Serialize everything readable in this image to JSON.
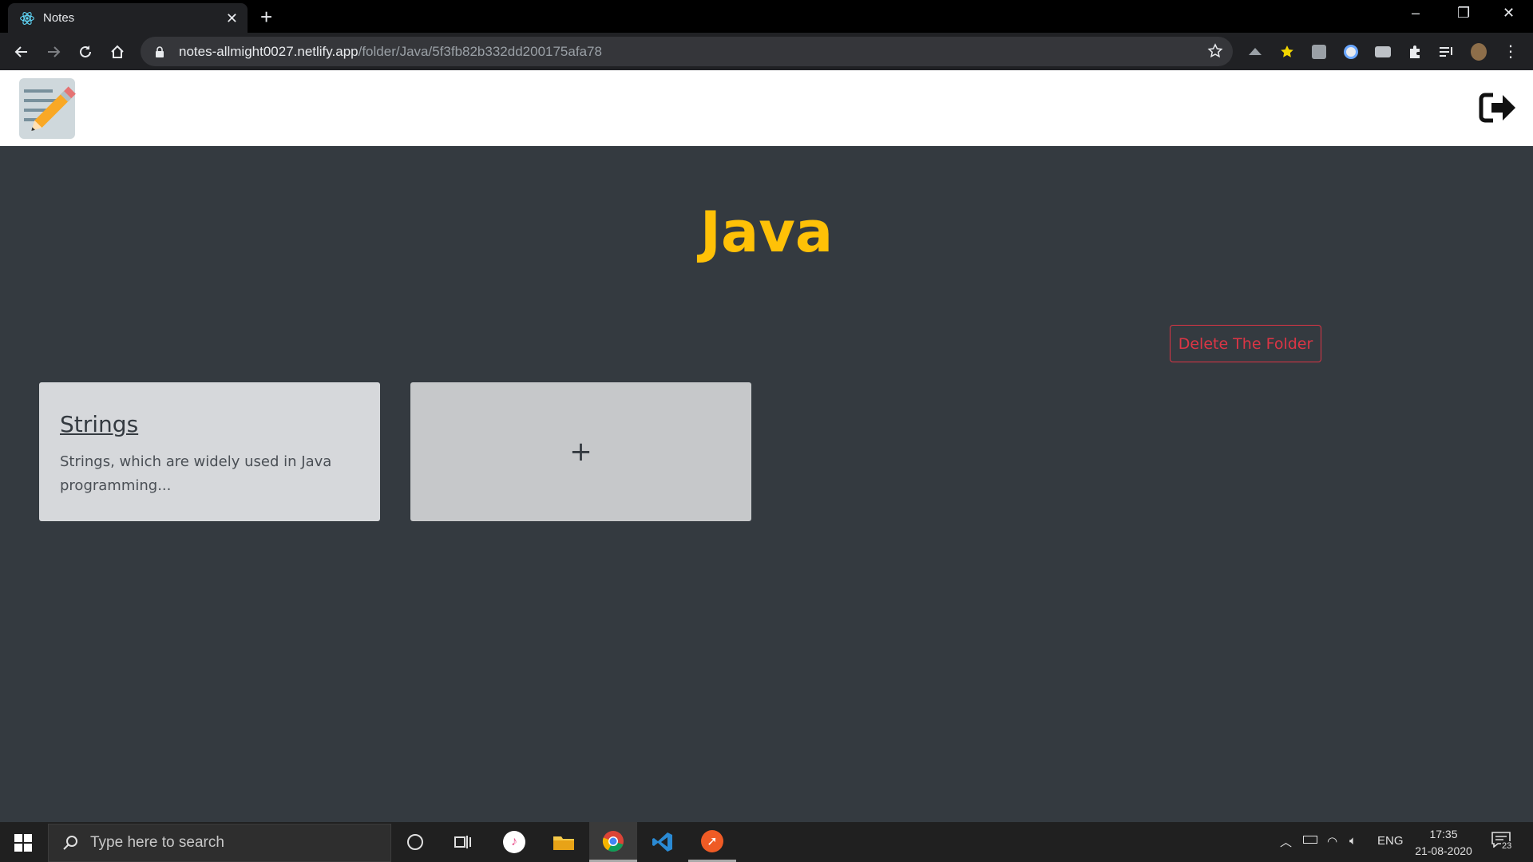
{
  "browser": {
    "tab_title": "Notes",
    "url_host": "notes-allmight0027.netlify.app",
    "url_path": "/folder/Java/5f3fb82b332dd200175afa78"
  },
  "page": {
    "folder_title": "Java",
    "delete_label": "Delete The Folder",
    "notes": [
      {
        "title": "Strings",
        "snippet": "Strings, which are widely used in Java programming..."
      }
    ],
    "add_label": "+"
  },
  "taskbar": {
    "search_placeholder": "Type here to search",
    "language": "ENG",
    "time": "17:35",
    "date": "21-08-2020",
    "notifications": "23"
  },
  "colors": {
    "page_bg": "#343a40",
    "title": "#ffc107",
    "danger": "#dc3545",
    "card": "#d6d8db"
  }
}
